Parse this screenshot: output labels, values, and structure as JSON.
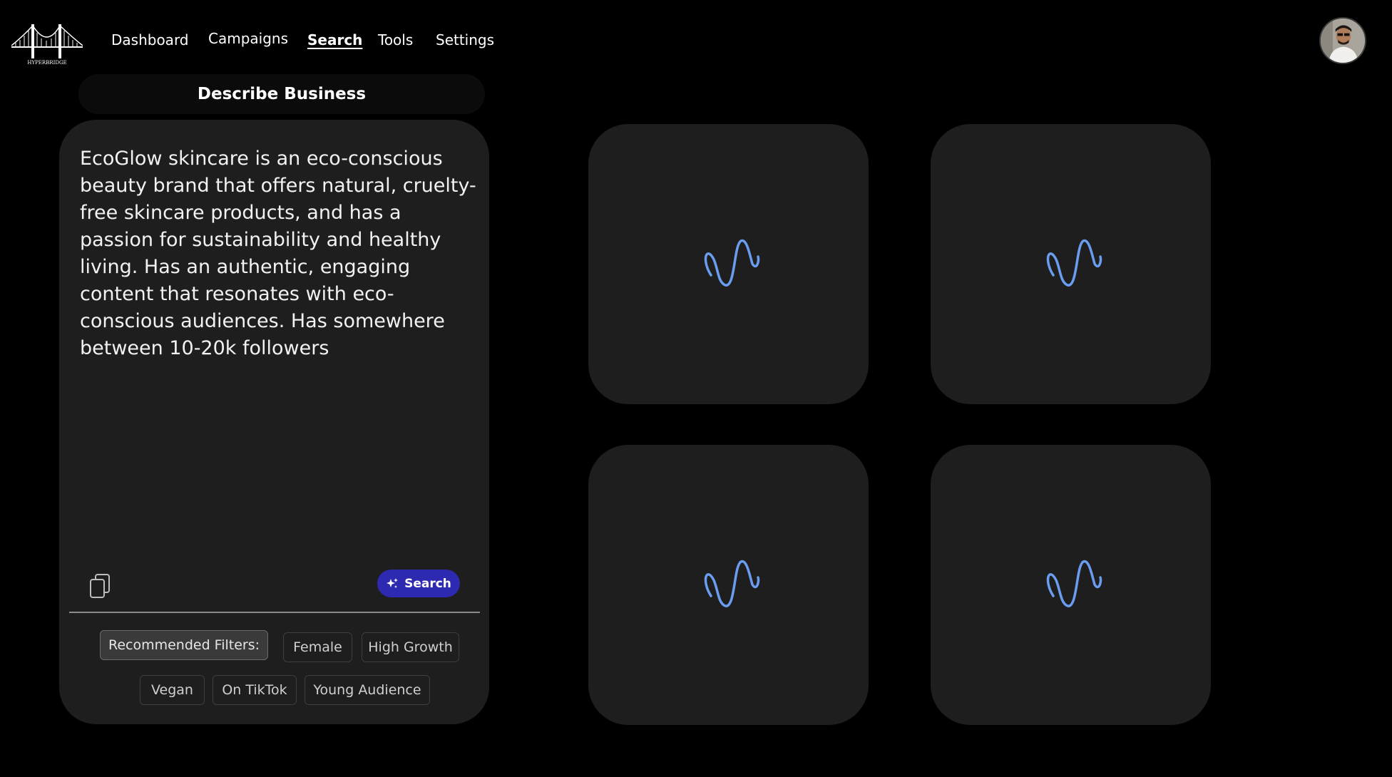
{
  "brand": {
    "logo_name": "HYPERBRIDGE"
  },
  "nav": {
    "items": [
      {
        "label": "Dashboard",
        "active": false
      },
      {
        "label": "Campaigns",
        "active": false
      },
      {
        "label": "Search",
        "active": true
      },
      {
        "label": "Tools",
        "active": false
      },
      {
        "label": "Settings",
        "active": false
      }
    ]
  },
  "main": {
    "section_title": "Describe Business",
    "description": "EcoGlow skincare is an eco-conscious beauty brand that offers natural, cruelty-free skincare products, and has a passion for sustainability and healthy living. Has an authentic, engaging content that resonates with eco-conscious audiences. Has somewhere between 10-20k followers",
    "search_button_label": "Search",
    "filters_label": "Recommended Filters:",
    "filters": [
      "Female",
      "High Growth",
      "Vegan",
      "On TikTok",
      "Young Audience"
    ]
  },
  "results": {
    "card_count": 4,
    "icon": "loading-wave-icon"
  },
  "colors": {
    "background": "#000000",
    "panel": "#1e1e1f",
    "accent": "#2d29b0",
    "wave": "#6a9cf0"
  }
}
